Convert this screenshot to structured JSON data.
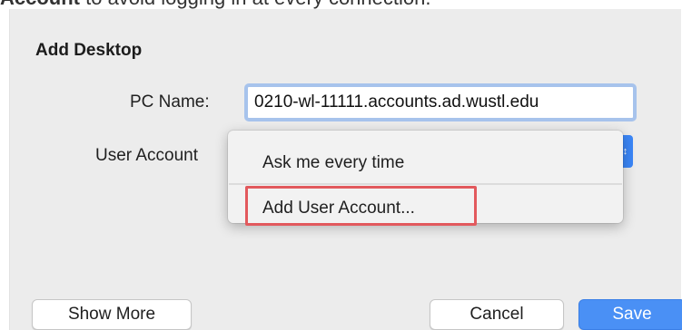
{
  "instruction": {
    "bold": "Account",
    "rest": " to avoid logging in at every connection."
  },
  "dialog": {
    "section_title": "Add Desktop",
    "pc_name_label": "PC Name:",
    "pc_name_value": "0210-wl-11111.accounts.ad.wustl.edu",
    "user_account_label": "User Account",
    "stepper_icon": "up-down-chevron-icon"
  },
  "user_account_menu": {
    "items": [
      {
        "label": "Ask me every time"
      },
      {
        "label": "Add User Account..."
      }
    ],
    "highlighted_index": 1,
    "highlight_color": "#e2595d"
  },
  "buttons": {
    "show_more": "Show More",
    "cancel": "Cancel",
    "save": "Save"
  },
  "colors": {
    "accent": "#4a90f5",
    "focus_ring": "#a7c3ec",
    "sheet_background": "#ececec"
  }
}
